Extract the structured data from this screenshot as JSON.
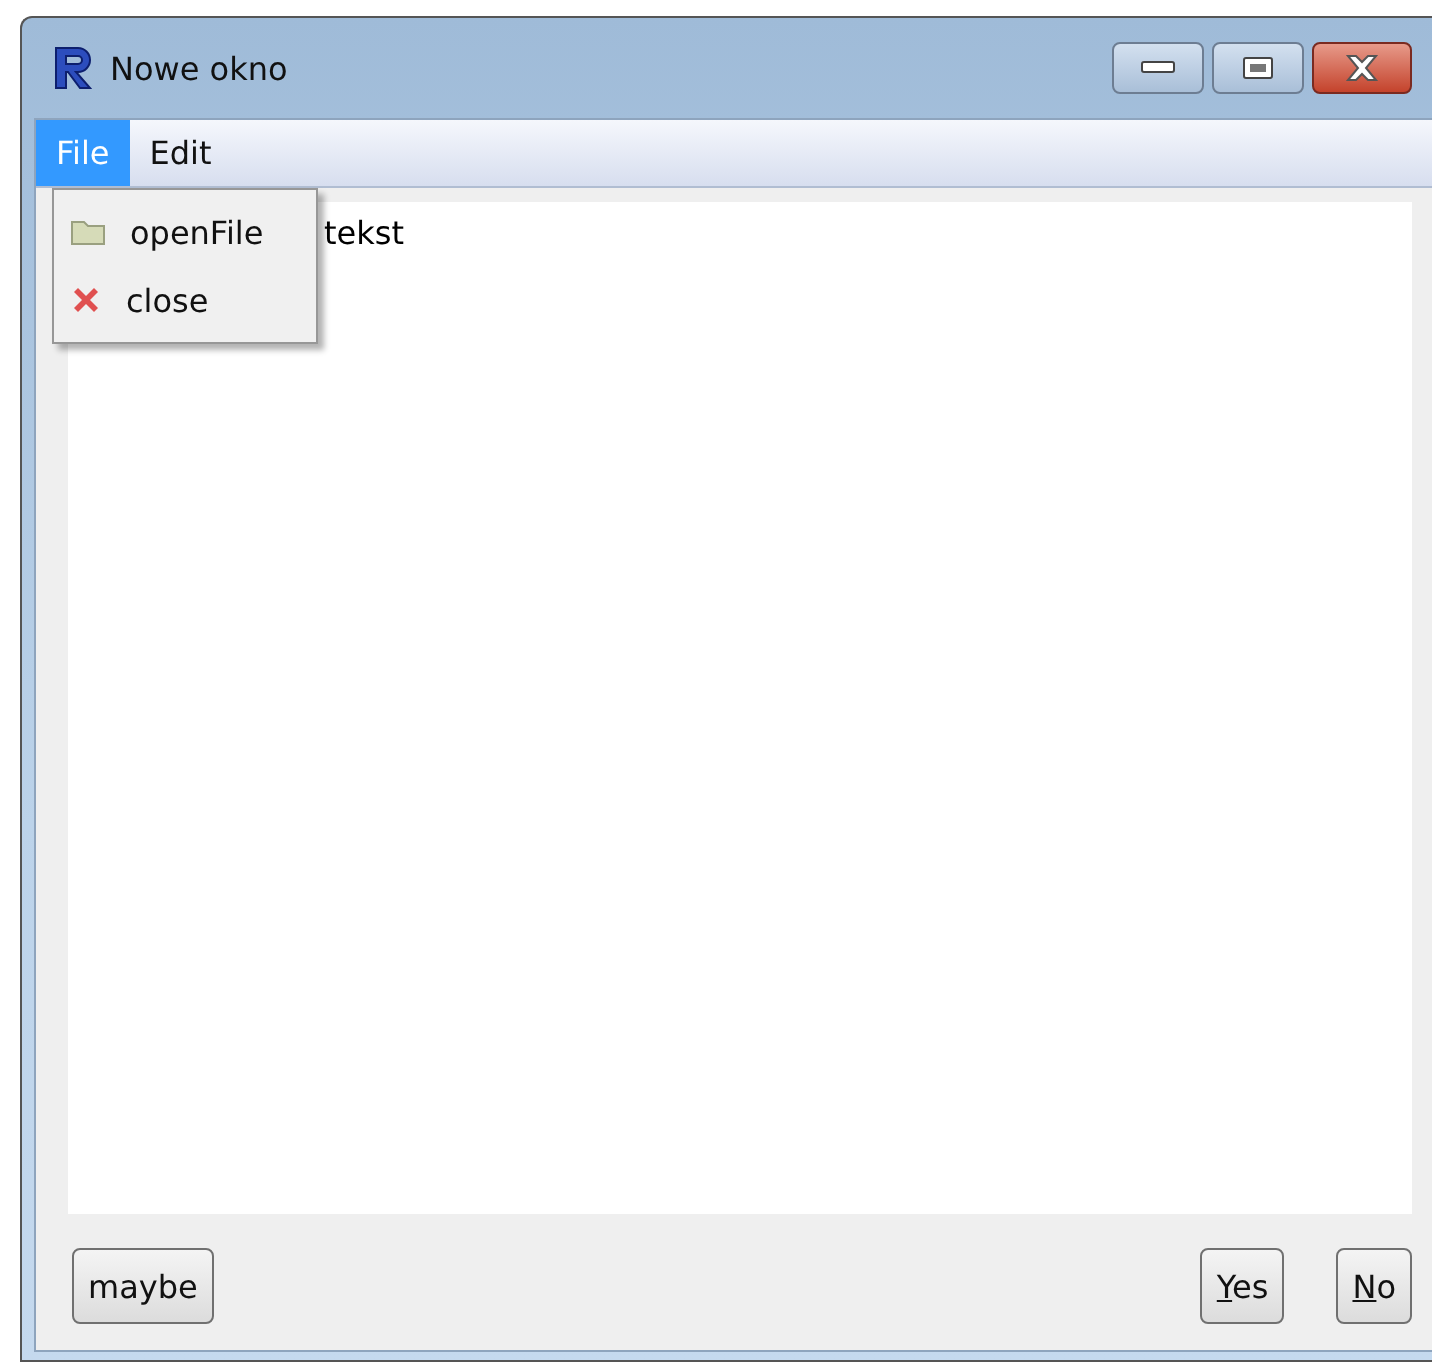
{
  "window": {
    "title": "Nowe okno"
  },
  "menubar": [
    {
      "label": "File",
      "selected": true
    },
    {
      "label": "Edit",
      "selected": false
    }
  ],
  "open_menu": {
    "items": [
      {
        "label": "openFile",
        "kind": "folder"
      },
      {
        "label": "close",
        "kind": "close"
      }
    ]
  },
  "text_area": {
    "value": "tekst"
  },
  "buttons": [
    {
      "label": "maybe",
      "underline_first": false
    },
    {
      "label": "Yes",
      "underline_first": true
    },
    {
      "label": "No",
      "underline_first": true
    }
  ]
}
